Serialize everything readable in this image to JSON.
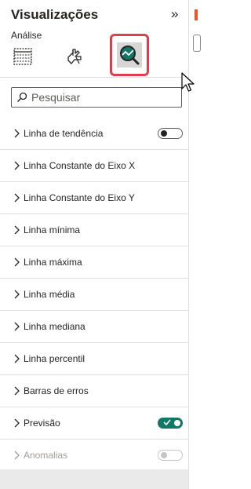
{
  "pane": {
    "title": "Visualizações",
    "collapse_glyph": "»",
    "subtitle": "Análise",
    "tabs": [
      {
        "icon": "fields-table-icon",
        "selected": false
      },
      {
        "icon": "format-paintbrush-icon",
        "selected": false
      },
      {
        "icon": "analytics-magnifier-icon",
        "selected": true
      }
    ]
  },
  "search": {
    "placeholder": "Pesquisar"
  },
  "items": [
    {
      "label": "Linha de tendência",
      "toggle": "off"
    },
    {
      "label": "Linha Constante do Eixo X"
    },
    {
      "label": "Linha Constante do Eixo Y"
    },
    {
      "label": "Linha mínima"
    },
    {
      "label": "Linha máxima"
    },
    {
      "label": "Linha média"
    },
    {
      "label": "Linha mediana"
    },
    {
      "label": "Linha percentil"
    },
    {
      "label": "Barras de erros"
    },
    {
      "label": "Previsão",
      "toggle": "on"
    },
    {
      "label": "Anomalias",
      "toggle": "disabled"
    }
  ],
  "colors": {
    "selected_outline": "#e03e4b",
    "toggle_on": "#117865",
    "accent": "#e8562a"
  }
}
